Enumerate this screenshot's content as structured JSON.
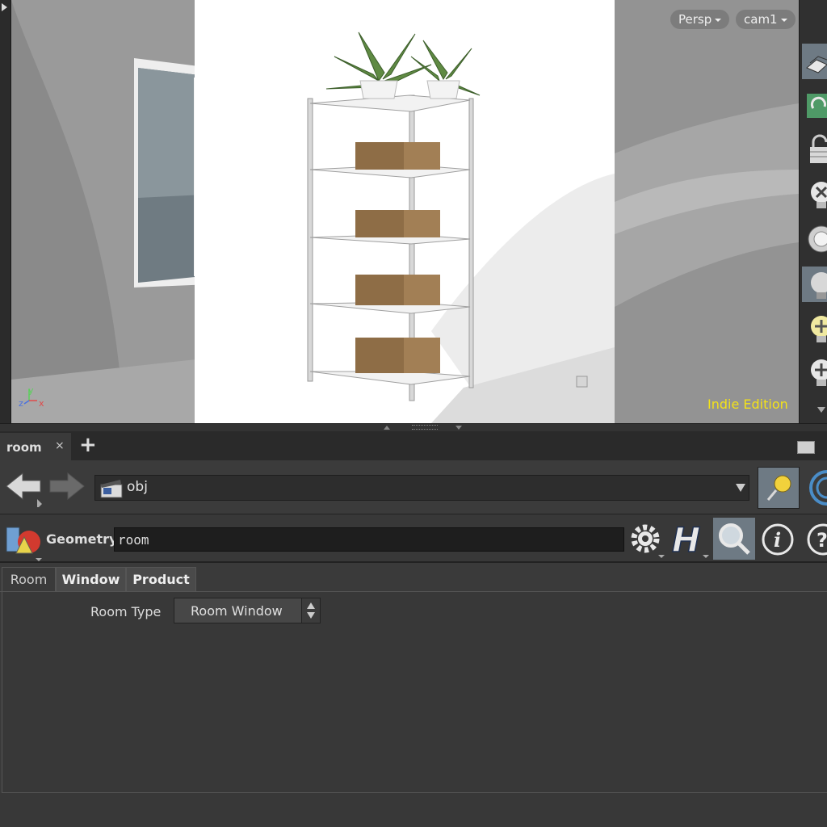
{
  "viewport": {
    "camera_mode": "Persp",
    "camera_name": "cam1",
    "edition": "Indie Edition",
    "axis": {
      "y": "y",
      "z": "z",
      "x": "x"
    },
    "edition_color": "#f3e219"
  },
  "tab": {
    "name": "room",
    "close": "×",
    "add": "+"
  },
  "nav": {
    "path": "obj"
  },
  "param_header": {
    "type_label": "Geometry",
    "node_name": "room"
  },
  "param_tabs": [
    {
      "label": "Room",
      "active": false
    },
    {
      "label": "Window",
      "active": true
    },
    {
      "label": "Product",
      "active": false
    }
  ],
  "params": {
    "room_type_label": "Room Type",
    "room_type_value": "Room Window"
  },
  "icons": {
    "nav_back": "arrow-left-icon",
    "nav_forward": "arrow-right-icon",
    "path": "clapperboard-icon",
    "pin": "pin-icon",
    "node_type": "geometry-icon",
    "gear": "gear-icon",
    "houdini": "houdini-h-icon",
    "search": "magnifier-icon",
    "info": "info-icon",
    "help": "help-icon"
  }
}
